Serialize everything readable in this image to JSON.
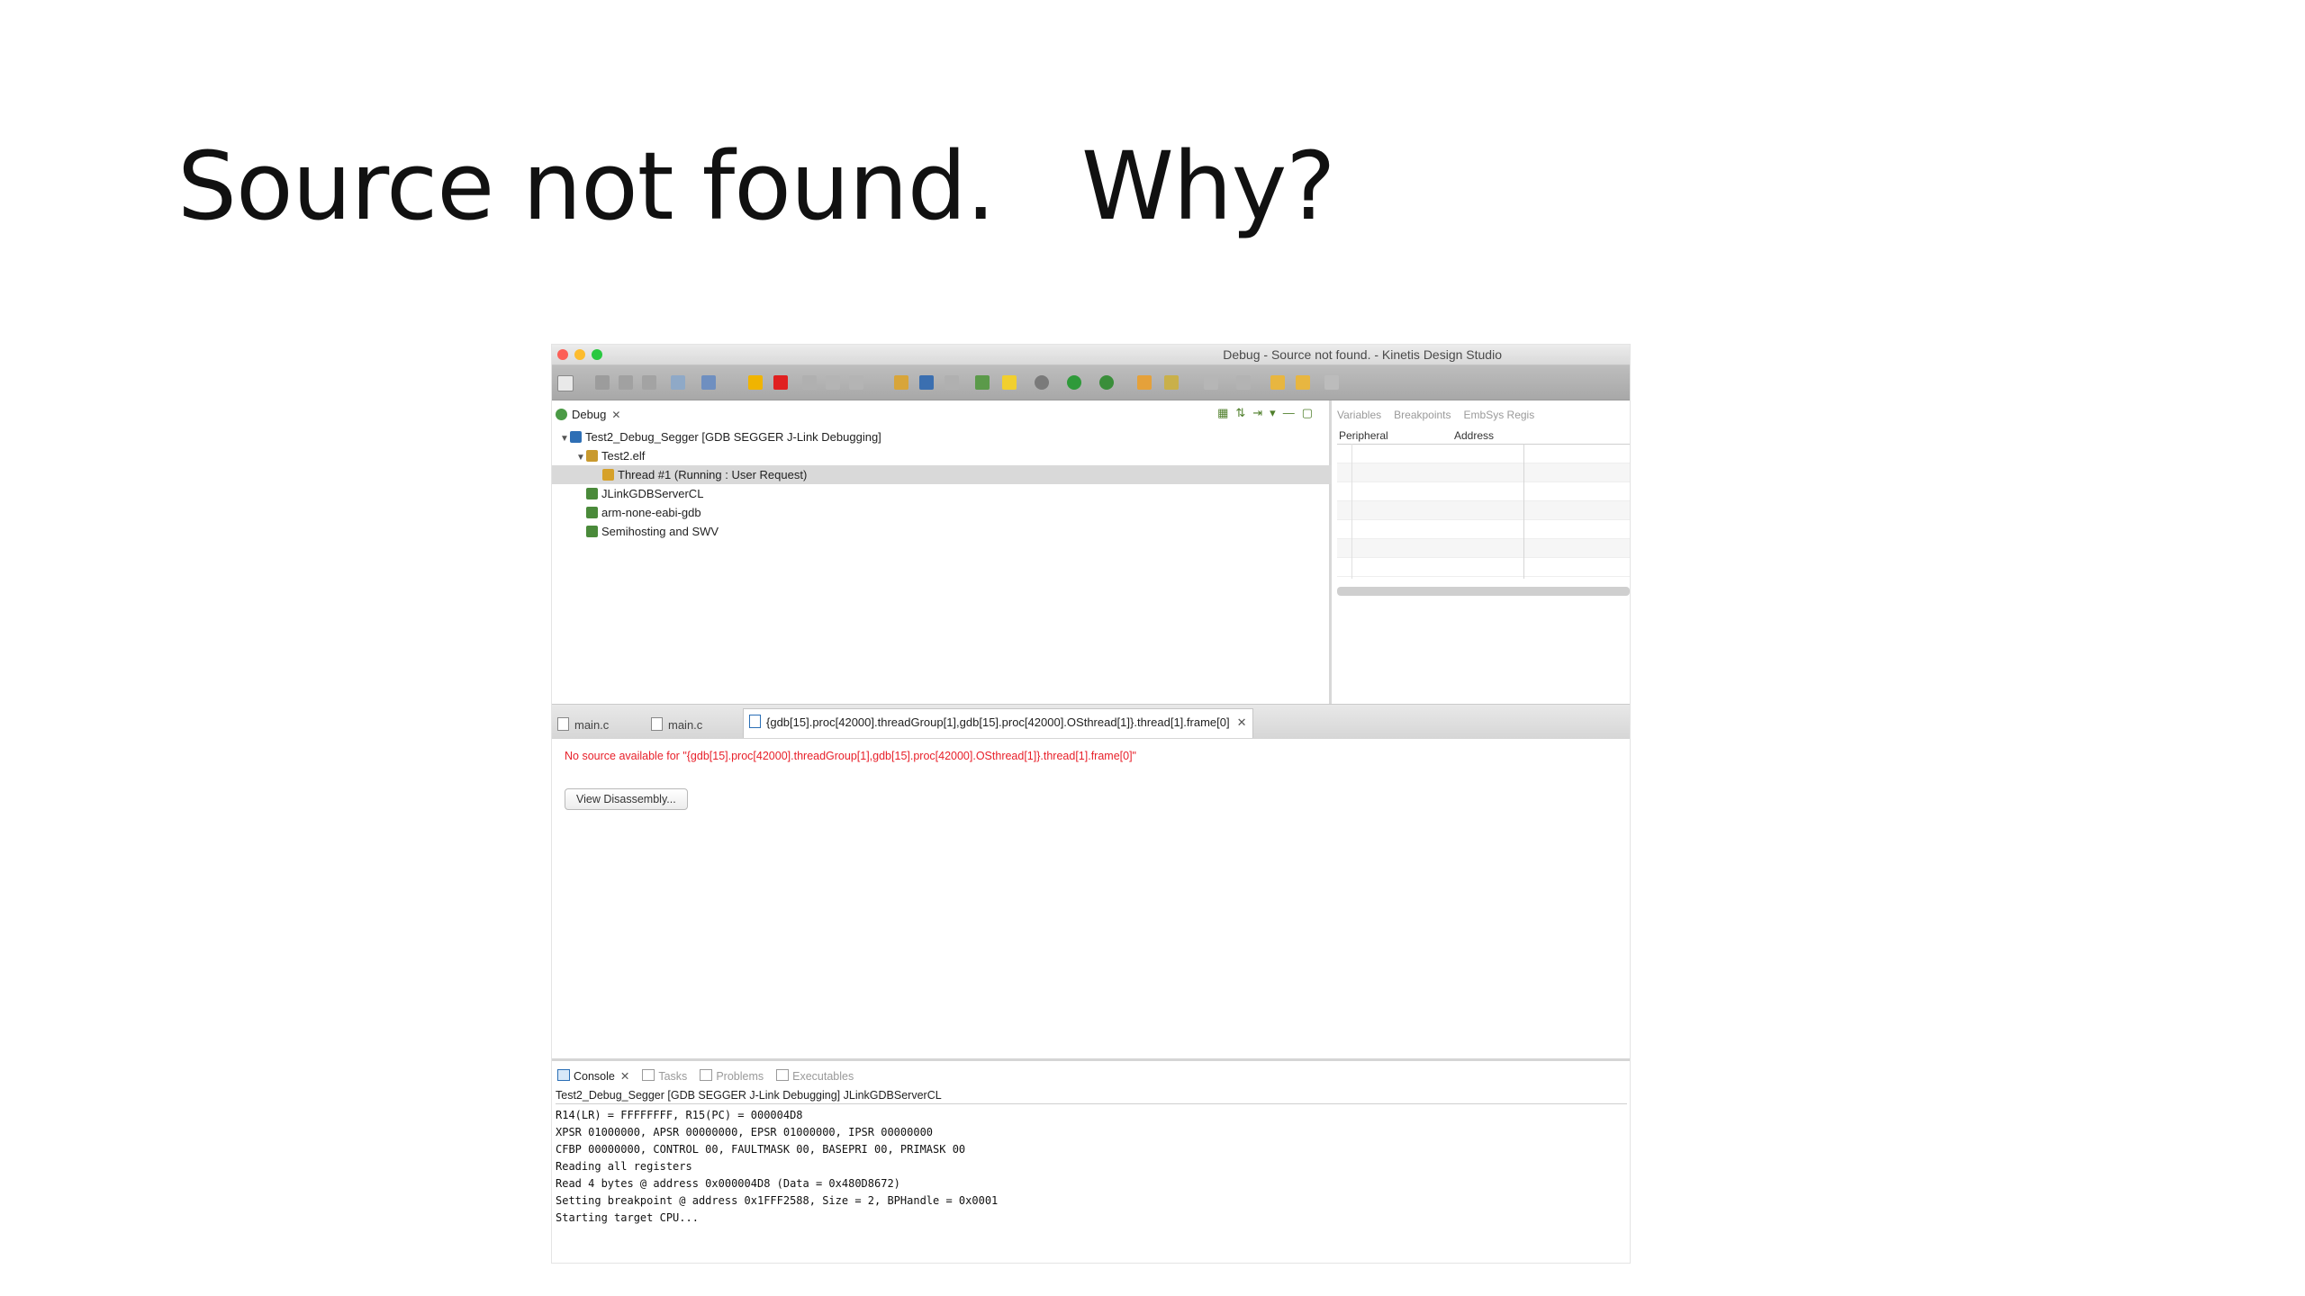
{
  "slide": {
    "title": "Source not found.   Why?"
  },
  "window": {
    "title": "Debug - Source not found. - Kinetis Design Studio"
  },
  "debug_view": {
    "tab_label": "Debug",
    "tree": [
      {
        "label": "Test2_Debug_Segger [GDB SEGGER J-Link Debugging]",
        "indent": 0,
        "twisty": "▼",
        "icon_color": "#2e6fb5"
      },
      {
        "label": "Test2.elf",
        "indent": 1,
        "twisty": "▼",
        "icon_color": "#c99a2e"
      },
      {
        "label": "Thread #1 (Running : User Request)",
        "indent": 2,
        "twisty": "",
        "icon_color": "#d6a12a",
        "selected": true
      },
      {
        "label": "JLinkGDBServerCL",
        "indent": 1,
        "twisty": "",
        "icon_color": "#4a8a3a"
      },
      {
        "label": "arm-none-eabi-gdb",
        "indent": 1,
        "twisty": "",
        "icon_color": "#4a8a3a"
      },
      {
        "label": "Semihosting and SWV",
        "indent": 1,
        "twisty": "",
        "icon_color": "#4a8a3a"
      }
    ]
  },
  "peripherals_view": {
    "tabs": [
      "Variables",
      "Breakpoints",
      "EmbSys Regis"
    ],
    "columns": [
      "Peripheral",
      "Address"
    ]
  },
  "editor": {
    "tabs": [
      "main.c",
      "main.c",
      "{gdb[15].proc[42000].threadGroup[1],gdb[15].proc[42000].OSthread[1]}.thread[1].frame[0]"
    ],
    "error_message": "No source available for \"{gdb[15].proc[42000].threadGroup[1],gdb[15].proc[42000].OSthread[1]}.thread[1].frame[0]\"",
    "view_disassembly_label": "View Disassembly..."
  },
  "console": {
    "tabs": [
      "Console",
      "Tasks",
      "Problems",
      "Executables"
    ],
    "process_label": "Test2_Debug_Segger [GDB SEGGER J-Link Debugging] JLinkGDBServerCL",
    "lines": [
      "R14(LR) = FFFFFFFF, R15(PC) = 000004D8",
      "XPSR 01000000, APSR 00000000, EPSR 01000000, IPSR 00000000",
      "CFBP 00000000, CONTROL 00, FAULTMASK 00, BASEPRI 00, PRIMASK 00",
      "Reading all registers",
      "Read 4 bytes @ address 0x000004D8 (Data = 0x480D8672)",
      "Setting breakpoint @ address 0x1FFF2588, Size = 2, BPHandle = 0x0001",
      "Starting target CPU..."
    ]
  },
  "colors": {
    "error_text": "#e8202a",
    "traffic_red": "#fc5f57",
    "traffic_yellow": "#fdbc2e",
    "traffic_green": "#29c840"
  }
}
